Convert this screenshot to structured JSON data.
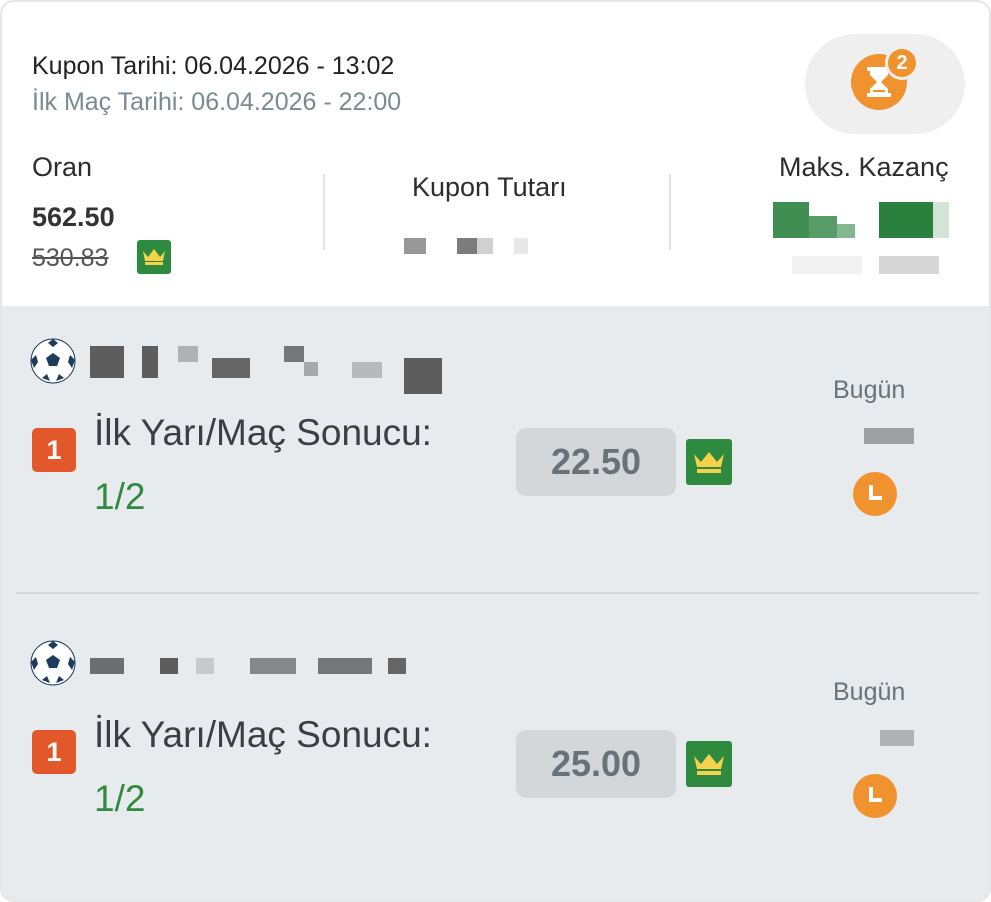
{
  "coupon": {
    "date_label": "Kupon Tarihi: 06.04.2026 - 13:02",
    "first_match_label": "İlk Maç Tarihi: 06.04.2026 - 22:00",
    "pending_count": "2",
    "oran_label": "Oran",
    "oran_value": "562.50",
    "oran_old_value": "530.83",
    "tutar_label": "Kupon Tutarı",
    "kazanc_label": "Maks. Kazanç"
  },
  "matches": [
    {
      "sport_icon": "soccer-ball-icon",
      "result_badge": "1",
      "market": "İlk Yarı/Maç Sonucu:",
      "pick": "1/2",
      "odd": "22.50",
      "day": "Bugün"
    },
    {
      "sport_icon": "soccer-ball-icon",
      "result_badge": "1",
      "market": "İlk Yarı/Maç Sonucu:",
      "pick": "1/2",
      "odd": "25.00",
      "day": "Bugün"
    }
  ],
  "colors": {
    "accent_orange": "#f0922e",
    "crown_green": "#2e8a3e",
    "pick_green": "#2f8a3e",
    "badge_red": "#e2582a"
  }
}
